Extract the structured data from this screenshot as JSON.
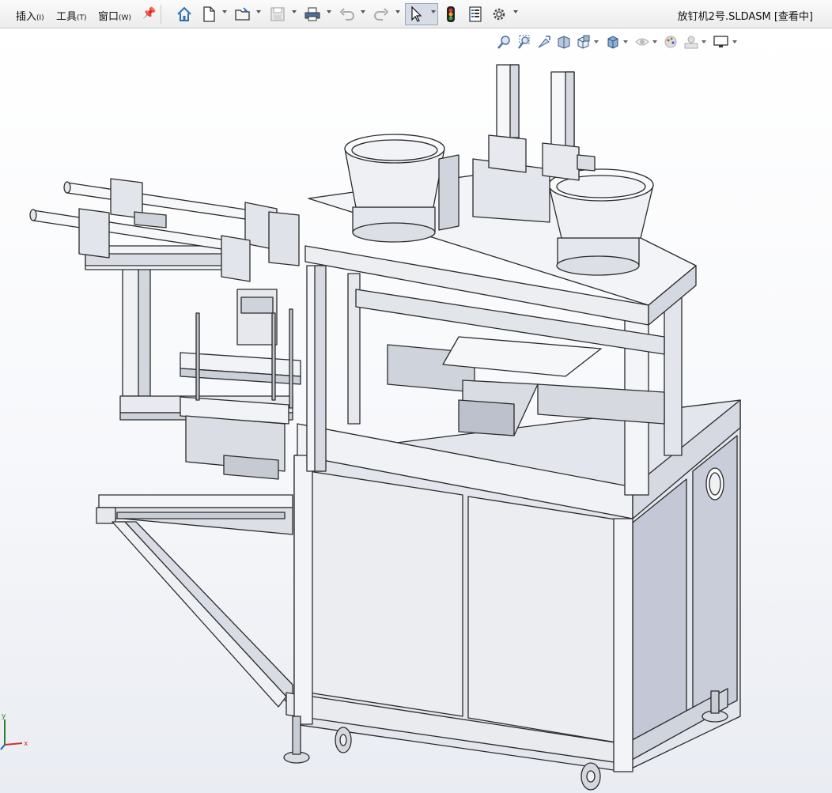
{
  "menu": {
    "items": [
      {
        "label": "插入",
        "key": "(I)"
      },
      {
        "label": "工具",
        "key": "(T)"
      },
      {
        "label": "窗口",
        "key": "(W)"
      }
    ]
  },
  "toolbar": {
    "icons": [
      "home-icon",
      "new-document-icon",
      "open-folder-icon",
      "save-icon",
      "print-icon",
      "undo-icon",
      "redo-icon",
      "select-pointer-icon",
      "rebuild-traffic-light-icon",
      "file-properties-icon",
      "options-gear-icon"
    ]
  },
  "document": {
    "title": "放钉机2号.SLDASM [查看中]"
  },
  "heads_up_toolbar": {
    "icons": [
      "zoom-to-fit-icon",
      "zoom-area-icon",
      "previous-view-icon",
      "section-view-icon",
      "view-orientation-icon",
      "display-style-icon",
      "hide-show-items-icon",
      "edit-appearance-icon",
      "apply-scene-icon",
      "view-settings-icon"
    ]
  },
  "triad": {
    "x_label": "x",
    "y_label": "y"
  },
  "colors": {
    "accent": "#2f6db3",
    "menubar": "#f0f0f0",
    "model_face": "#eceef3",
    "model_edge": "#2b2b2b"
  }
}
